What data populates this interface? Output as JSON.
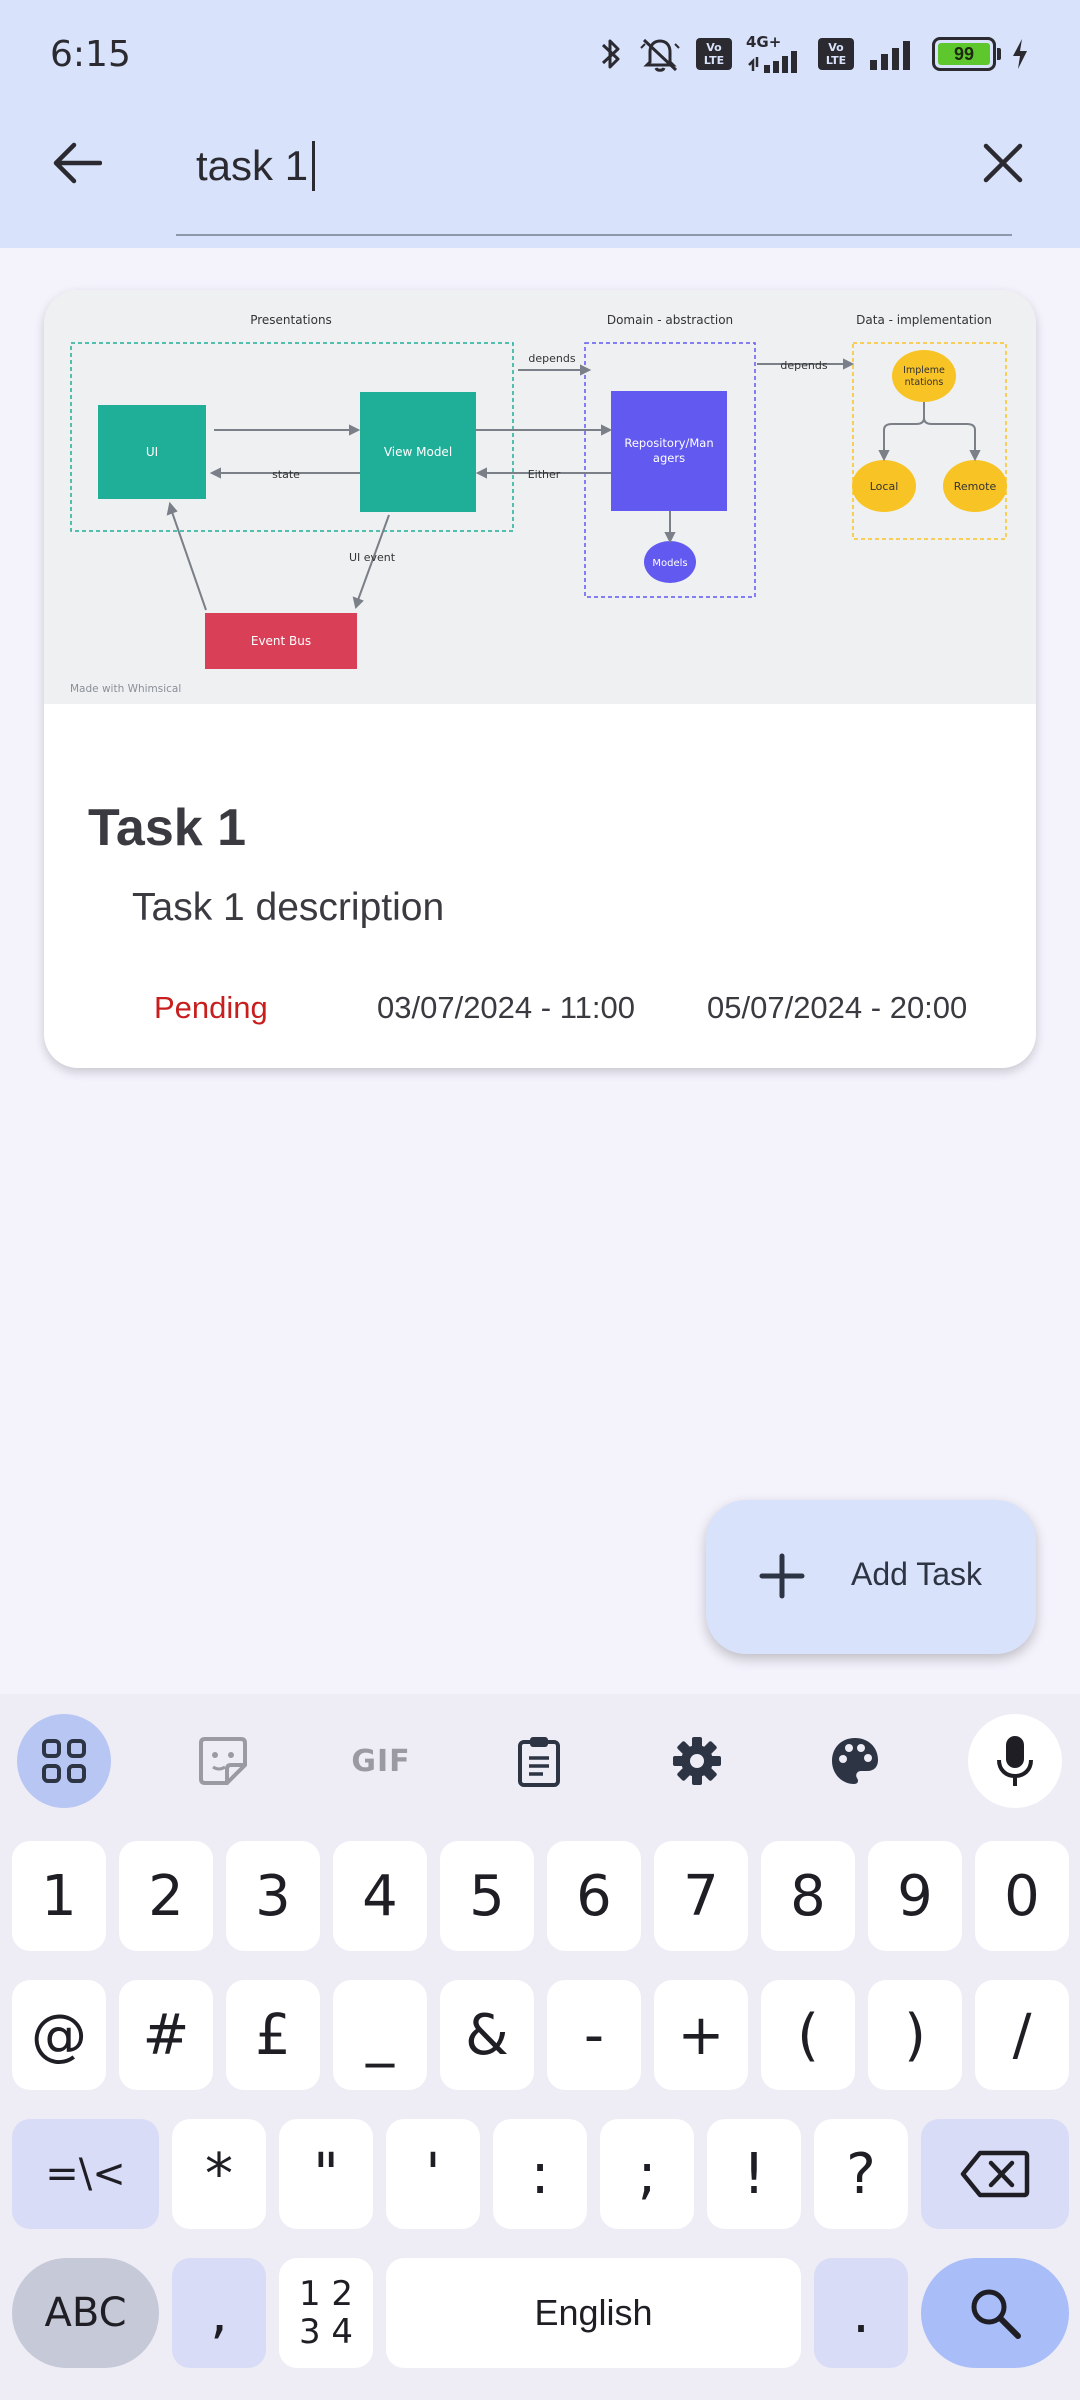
{
  "status_bar": {
    "time": "6:15",
    "network_label": "4G+",
    "volte_label_1": "Vo LTE",
    "volte_label_2": "Vo LTE",
    "battery_level": "99",
    "icons": [
      "bluetooth-icon",
      "silent-icon",
      "signal-icon",
      "battery-icon",
      "charging-icon"
    ]
  },
  "search": {
    "query": "task 1",
    "back_icon": "arrow-left-icon",
    "clear_icon": "close-icon"
  },
  "task_card": {
    "image": {
      "sections": [
        "Presentations",
        "Domain - abstraction",
        "Data - implementation"
      ],
      "boxes": {
        "ui": "UI",
        "view_model": "View Model",
        "repository": "Repository/Managers",
        "models": "Models",
        "event_bus": "Event Bus",
        "implementations": "Implementations",
        "local": "Local",
        "remote": "Remote"
      },
      "arrows": {
        "depends_1": "depends",
        "depends_2": "depends",
        "state": "state",
        "either": "Either",
        "ui_event": "UI event"
      },
      "watermark": "Made with Whimsical",
      "colors": {
        "teal": "#1fae98",
        "purple": "#6259f1",
        "red": "#d94058",
        "yellow": "#f8c325"
      }
    },
    "title": "Task 1",
    "description": "Task 1 description",
    "status": "Pending",
    "status_color": "#c81e1e",
    "start": "03/07/2024 - 11:00",
    "end": "05/07/2024 - 20:00"
  },
  "fab": {
    "label": "Add Task",
    "icon": "plus-icon"
  },
  "keyboard": {
    "toolbar": [
      "apps-grid-icon",
      "sticker-icon",
      "GIF",
      "clipboard-icon",
      "settings-icon",
      "palette-icon",
      "microphone-icon"
    ],
    "row1": [
      "1",
      "2",
      "3",
      "4",
      "5",
      "6",
      "7",
      "8",
      "9",
      "0"
    ],
    "row2": [
      "@",
      "#",
      "£",
      "_",
      "&",
      "-",
      "+",
      "(",
      ")",
      "/"
    ],
    "row3": [
      "=\\<",
      "*",
      "\"",
      "'",
      ":",
      ";",
      "!",
      "?"
    ],
    "row3_backspace": "backspace-icon",
    "row4": {
      "abc": "ABC",
      "comma": ",",
      "numtoggle_top": "1 2",
      "numtoggle_bottom": "3 4",
      "space": "English",
      "period": ".",
      "search": "search-icon"
    }
  }
}
